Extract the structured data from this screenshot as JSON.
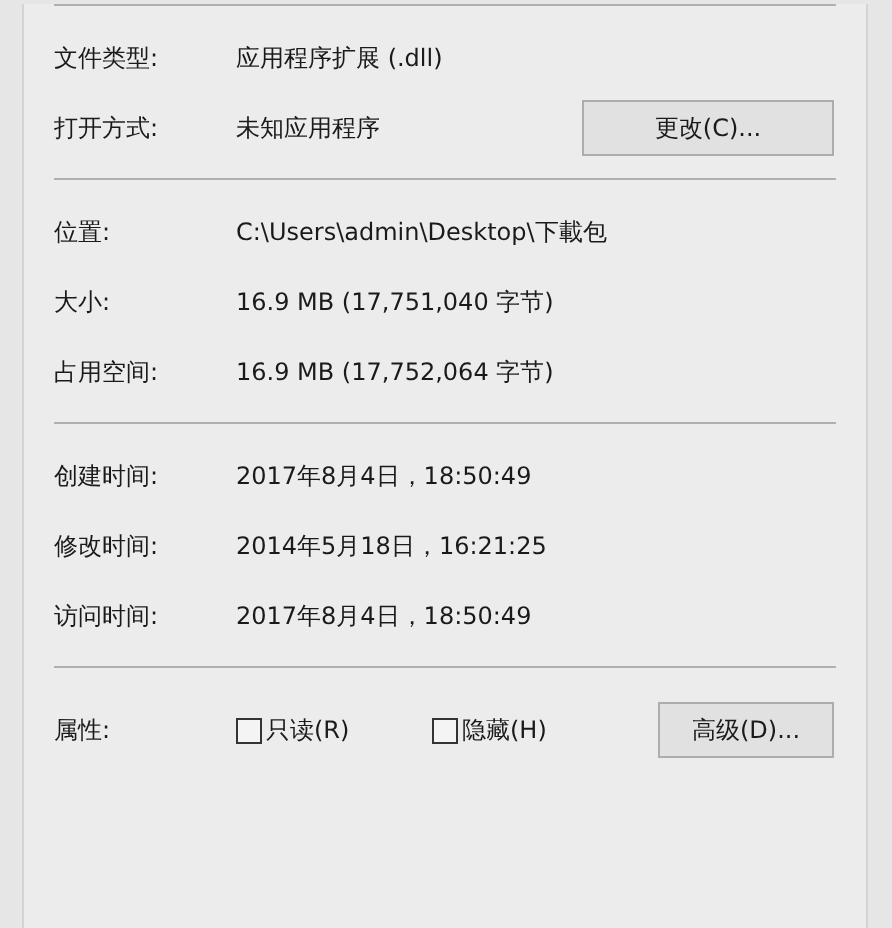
{
  "sections": [
    {
      "rows": [
        {
          "label": "文件类型:",
          "value": "应用程序扩展 (.dll)"
        },
        {
          "label": "打开方式:",
          "value": "未知应用程序",
          "button": "更改(C)..."
        }
      ]
    },
    {
      "rows": [
        {
          "label": "位置:",
          "value": "C:\\Users\\admin\\Desktop\\下載包"
        },
        {
          "label": "大小:",
          "value": "16.9 MB (17,751,040 字节)"
        },
        {
          "label": "占用空间:",
          "value": "16.9 MB (17,752,064 字节)"
        }
      ]
    },
    {
      "rows": [
        {
          "label": "创建时间:",
          "value": "2017年8月4日，18:50:49"
        },
        {
          "label": "修改时间:",
          "value": "2014年5月18日，16:21:25"
        },
        {
          "label": "访问时间:",
          "value": "2017年8月4日，18:50:49"
        }
      ]
    }
  ],
  "attributes": {
    "label": "属性:",
    "checkboxes": [
      {
        "label": "只读(R)",
        "checked": false
      },
      {
        "label": "隐藏(H)",
        "checked": false
      }
    ],
    "button": "高级(D)..."
  }
}
